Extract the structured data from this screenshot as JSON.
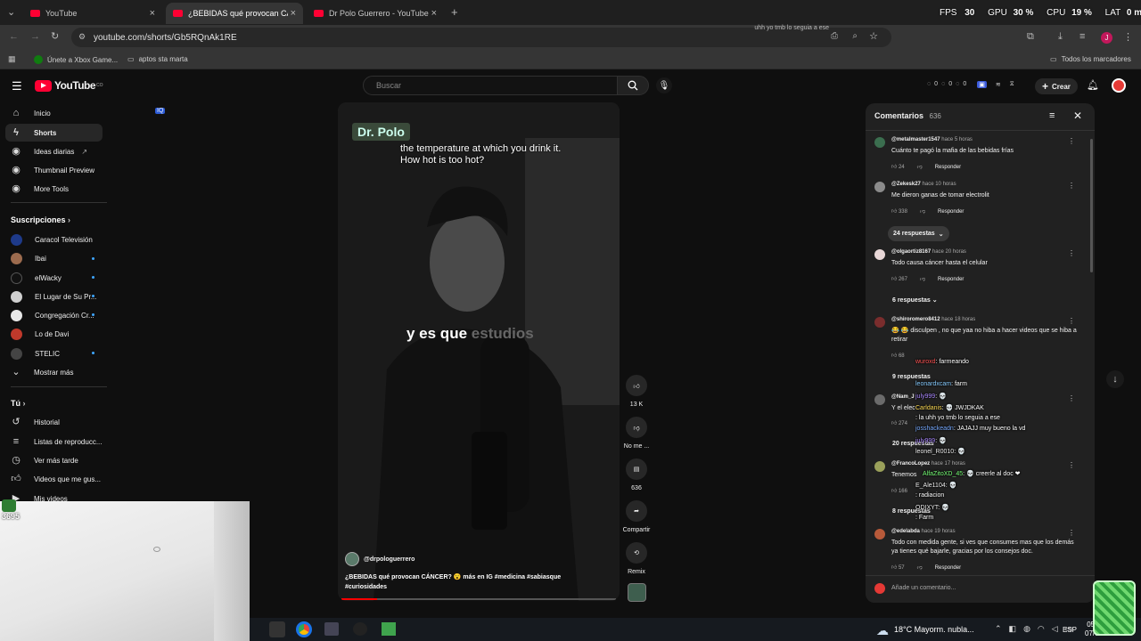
{
  "browser": {
    "tabs": [
      {
        "title": "YouTube"
      },
      {
        "title": "¿BEBIDAS qué provocan CÁNCER?"
      },
      {
        "title": "Dr Polo Guerrero - YouTube"
      }
    ],
    "url": "youtube.com/shorts/Gb5RQnAk1RE",
    "bookmarks": [
      "Únete a Xbox Game...",
      "aptos sta marta"
    ],
    "all_bookmarks": "Todos los marcadores",
    "overlay_stats": {
      "fps_label": "FPS",
      "fps": "30",
      "gpu_label": "GPU",
      "gpu": "30 %",
      "cpu_label": "CPU",
      "cpu": "19 %",
      "lat_label": "LAT",
      "lat": "0 ms"
    },
    "overlay_chat_top": "uhh yo tmb lo seguia a ese",
    "profile_letter": "J"
  },
  "youtube": {
    "logo": "YouTube",
    "logo_sup": "CO",
    "search_placeholder": "Buscar",
    "header_counts": [
      "0",
      "0",
      "0"
    ],
    "create_label": "Crear",
    "sidebar": {
      "main": [
        {
          "label": "Inicio",
          "icon": "home-icon"
        },
        {
          "label": "Shorts",
          "icon": "shorts-icon"
        },
        {
          "label": "Ideas diarias",
          "icon": "ideas-icon"
        },
        {
          "label": "Thumbnail Preview",
          "icon": "thumbnail-icon"
        },
        {
          "label": "More Tools",
          "icon": "tools-icon"
        }
      ],
      "subs_title": "Suscripciones",
      "subs": [
        {
          "label": "Caracol Televisión",
          "color": "#1e3a8a"
        },
        {
          "label": "Ibai",
          "color": "#9c6b4e"
        },
        {
          "label": "elWacky",
          "color": "#111111"
        },
        {
          "label": "El Lugar de Su Pr...",
          "color": "#cfcfcf"
        },
        {
          "label": "Congregación Cr...",
          "color": "#e8e8e8"
        },
        {
          "label": "Lo de Davi",
          "color": "#c0392b"
        },
        {
          "label": "STELIC",
          "color": "#444444"
        }
      ],
      "show_more": "Mostrar más",
      "you_title": "Tú",
      "you": [
        {
          "label": "Historial",
          "icon": "history-icon"
        },
        {
          "label": "Listas de reproducc...",
          "icon": "playlist-icon"
        },
        {
          "label": "Ver más tarde",
          "icon": "clock-icon"
        },
        {
          "label": "Videos que me gus...",
          "icon": "like-icon"
        },
        {
          "label": "Mis videos",
          "icon": "video-icon"
        }
      ]
    },
    "video": {
      "watermark": "Dr. Polo",
      "caption_top_1": "the temperature at which you drink it.",
      "caption_top_2": "How hot is too hot?",
      "subtitle_a": "y es que",
      "subtitle_b": "estudios",
      "channel": "@drpologuerrero",
      "description": "¿BEBIDAS qué provocan CÁNCER? 😮 más en IG #medicina #sabiasque #curiosidades",
      "progress": 0.13
    },
    "actions": {
      "likes": "13 K",
      "dislike": "No me ...",
      "comments": "636",
      "share": "Compartir",
      "remix": "Remix"
    },
    "comments": {
      "title": "Comentarios",
      "count": "636",
      "add_placeholder": "Añade un comentario...",
      "reply_label": "Responder",
      "items": [
        {
          "author": "@metalmaster1547",
          "time": "hace 5 horas",
          "text": "Cuánto te pagó la mafia de las bebidas frías",
          "likes": "24",
          "avatar": "#3b6e4f"
        },
        {
          "author": "@Zekesk27",
          "time": "hace 10 horas",
          "text": "Me dieron ganas de tomar electrolit",
          "likes": "338",
          "avatar": "#8b8b8b",
          "replies": "24 respuestas"
        },
        {
          "author": "@olgaortiz8167",
          "time": "hace 20 horas",
          "text": "Todo causa cáncer hasta el celular",
          "likes": "267",
          "avatar": "#e8d7d7",
          "replies": "6 respuestas"
        },
        {
          "author": "@shiroromero8412",
          "time": "hace 18 horas",
          "text": "😂 😂 disculpen , no que yaa no hiba a hacer videos que se hiba a retirar",
          "likes": "68",
          "avatar": "#7a2d2d",
          "replies": "9 respuestas"
        },
        {
          "author": "@Nam_J",
          "time": "",
          "text": "Y el elec",
          "likes": "274",
          "avatar": "#6b6b6b",
          "replies": "20 respuestas"
        },
        {
          "author": "@FrancoLopez",
          "time": "hace 17 horas",
          "text": "Tenemos",
          "likes": "166",
          "avatar": "#9aa05a",
          "replies": "8 respuestas"
        },
        {
          "author": "@edelabda",
          "time": "hace 19 horas",
          "text": "Todo con medida gente, si ves que consumes mas que los demás ya tienes qué bajarle, gracias por los consejos doc.",
          "likes": "57",
          "avatar": "#b85a3a"
        }
      ]
    },
    "chat_overlay": [
      {
        "user": "wuroxd",
        "msg": ": farmeando"
      },
      {
        "user": "leonardxcam",
        "msg": ": farm"
      },
      {
        "user": "july999",
        "msg": ": 💀"
      },
      {
        "user": "Carldanis",
        "msg": ": 💀 JWJDKAK"
      },
      {
        "user": "",
        "msg": ": la uhh yo tmb lo seguia a ese"
      },
      {
        "user": "josshackeadn",
        "msg": ": JAJAJJ muy bueno la vd"
      },
      {
        "user": "july999",
        "msg": ": 💀"
      },
      {
        "user": "leonel_R0010",
        "msg": ": 💀"
      },
      {
        "user": "AlfaZitoXD_45",
        "msg": ": 💀 creerle al doc ❤"
      },
      {
        "user": "E_Ale1104",
        "msg": ": 💀"
      },
      {
        "user": "",
        "msg": ": radiacion"
      },
      {
        "user": "ODIXYT",
        "msg": ": 💀"
      },
      {
        "user": "",
        "msg": ": Farm"
      }
    ]
  },
  "streamer": {
    "badge": "3695"
  },
  "taskbar": {
    "weather": "18°C  Mayorm. nubla...",
    "lang": "ESP",
    "time": "05:34",
    "date": "07/01/"
  }
}
